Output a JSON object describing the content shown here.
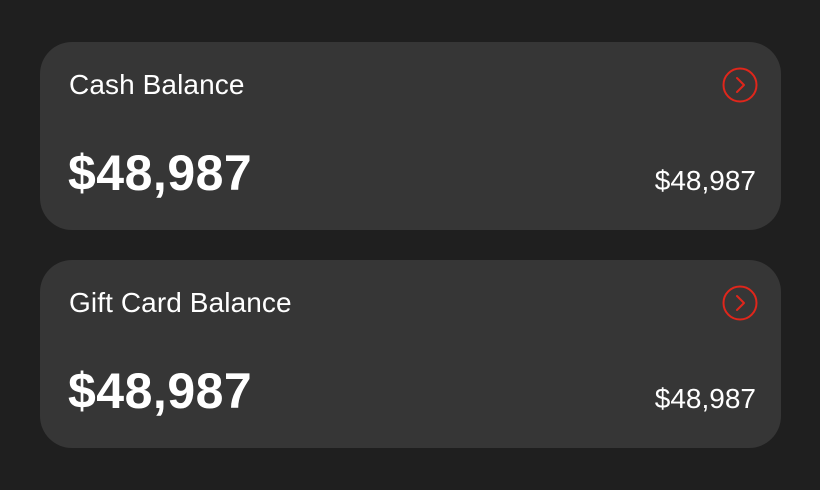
{
  "cards": [
    {
      "title": "Cash Balance",
      "amount": "$48,987",
      "secondary_amount": "$48,987",
      "action_icon": "chevron-right-circle-icon"
    },
    {
      "title": "Gift Card Balance",
      "amount": "$48,987",
      "secondary_amount": "$48,987",
      "action_icon": "chevron-right-circle-icon"
    }
  ],
  "colors": {
    "background": "#1f1f1f",
    "card": "#363636",
    "text": "#ffffff",
    "accent": "#e0261b"
  }
}
